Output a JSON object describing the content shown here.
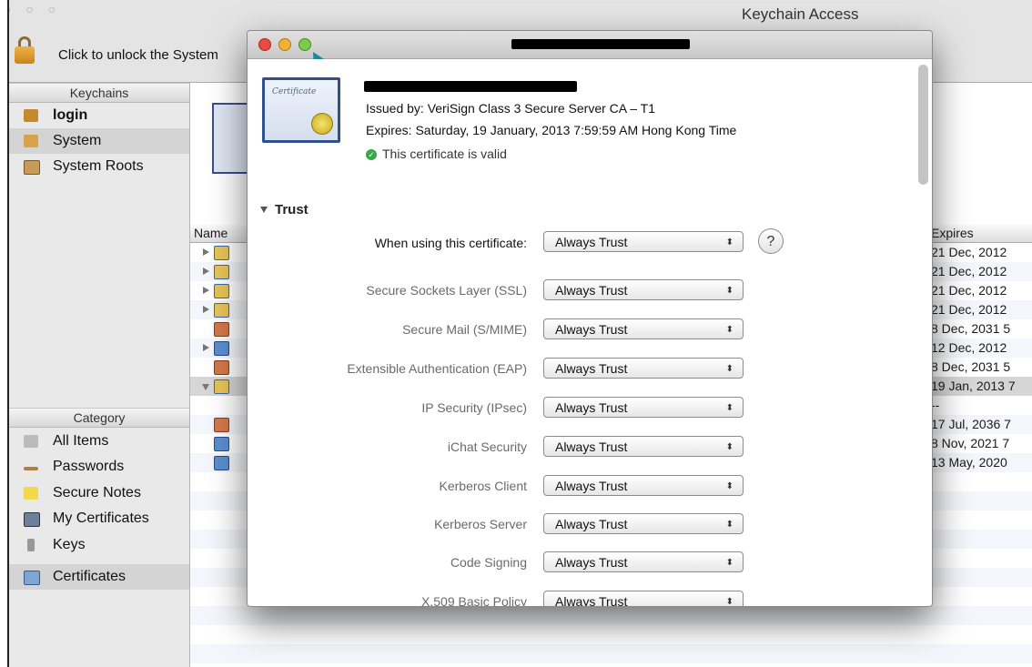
{
  "window": {
    "title": "Keychain Access",
    "lights_glyph": "○ ○ ○"
  },
  "toolbar": {
    "unlock_text": "Click to unlock the System"
  },
  "sidebar": {
    "keychains_header": "Keychains",
    "keychains": [
      {
        "label": "login",
        "icon": "unlocked-lock-icon"
      },
      {
        "label": "System",
        "icon": "lock-icon"
      },
      {
        "label": "System Roots",
        "icon": "cabinet-icon"
      }
    ],
    "category_header": "Category",
    "categories": [
      {
        "label": "All Items",
        "icon": "people-icon"
      },
      {
        "label": "Passwords",
        "icon": "pencil-icon"
      },
      {
        "label": "Secure Notes",
        "icon": "note-icon"
      },
      {
        "label": "My Certificates",
        "icon": "certificate-icon"
      },
      {
        "label": "Keys",
        "icon": "key-icon"
      },
      {
        "label": "Certificates",
        "icon": "certificate-icon"
      }
    ]
  },
  "list": {
    "col_name": "Name",
    "col_expires": "Expires",
    "rows": [
      {
        "expires": "21 Dec, 2012"
      },
      {
        "expires": "21 Dec, 2012"
      },
      {
        "expires": "21 Dec, 2012"
      },
      {
        "expires": "21 Dec, 2012"
      },
      {
        "expires": "8 Dec, 2031 5"
      },
      {
        "expires": "12 Dec, 2012"
      },
      {
        "expires": "8 Dec, 2031 5"
      },
      {
        "expires": "19 Jan, 2013 7"
      },
      {
        "expires": "--"
      },
      {
        "expires": "17 Jul, 2036 7"
      },
      {
        "expires": "8 Nov, 2021 7"
      },
      {
        "expires": "13 May, 2020"
      }
    ]
  },
  "dialog": {
    "cert_icon_text": "Certificate",
    "issued_by": "Issued by: VeriSign Class 3 Secure Server CA – T1",
    "expires": "Expires: Saturday, 19 January, 2013 7:59:59 AM Hong Kong Time",
    "valid": "This certificate is valid",
    "trust_header": "Trust",
    "when_using_label": "When using this certificate:",
    "when_using_value": "Always Trust",
    "help_glyph": "?",
    "popup_arrows": "⬍",
    "policies": [
      {
        "label": "Secure Sockets Layer (SSL)",
        "value": "Always Trust"
      },
      {
        "label": "Secure Mail (S/MIME)",
        "value": "Always Trust"
      },
      {
        "label": "Extensible Authentication (EAP)",
        "value": "Always Trust"
      },
      {
        "label": "IP Security (IPsec)",
        "value": "Always Trust"
      },
      {
        "label": "iChat Security",
        "value": "Always Trust"
      },
      {
        "label": "Kerberos Client",
        "value": "Always Trust"
      },
      {
        "label": "Kerberos Server",
        "value": "Always Trust"
      },
      {
        "label": "Code Signing",
        "value": "Always Trust"
      },
      {
        "label": "X.509 Basic Policy",
        "value": "Always Trust"
      }
    ]
  }
}
